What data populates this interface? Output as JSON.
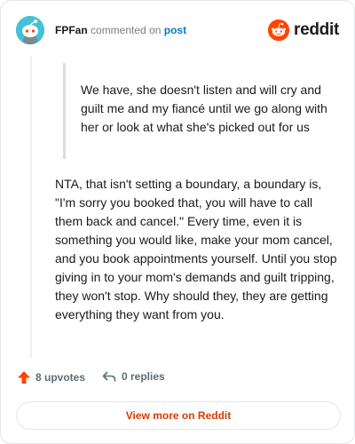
{
  "header": {
    "username": "FPFan",
    "commented_text": "commented on",
    "post_link": "post",
    "logo_text": "reddit"
  },
  "comment": {
    "quote": "We have, she doesn't listen and will cry and guilt me and my fiancé until we go along with her or look at what she's picked out for us",
    "body": "NTA, that isn't setting a boundary, a boundary is, \"I'm sorry you booked that, you will have to call them back and cancel.\" Every time, even it is something you would like, make your mom cancel, and you book appointments yourself. Until you stop giving in to your mom's demands and guilt tripping, they won't stop. Why should they, they are getting everything they want from you."
  },
  "actions": {
    "upvotes": "8 upvotes",
    "replies": "0 replies"
  },
  "footer": {
    "view_more": "View more on Reddit"
  },
  "colors": {
    "accent": "#ff4500",
    "link": "#0079d3",
    "cta": "#d93a00",
    "avatar_bg": "#44c1d6"
  }
}
